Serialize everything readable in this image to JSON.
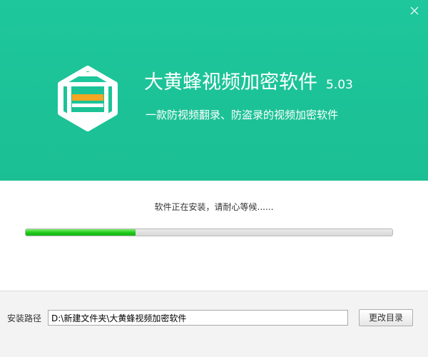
{
  "header": {
    "app_title": "大黄蜂视频加密软件",
    "version": "5.03",
    "subtitle": "一款防视频翻录、防盗录的视频加密软件",
    "close_icon": "close-icon",
    "logo_icon": "hexagon-shield-logo-icon",
    "colors": {
      "header_bg": "#1ec79c",
      "logo_bar": "#f5a623",
      "text": "#ffffff"
    }
  },
  "install": {
    "status_text": "软件正在安装，请耐心等候......",
    "progress": 0.3,
    "progress_color": "#1fc81a"
  },
  "footer": {
    "path_label": "安装路径",
    "path_value": "D:\\新建文件夹\\大黄蜂视频加密软件",
    "change_button_label": "更改目录"
  }
}
